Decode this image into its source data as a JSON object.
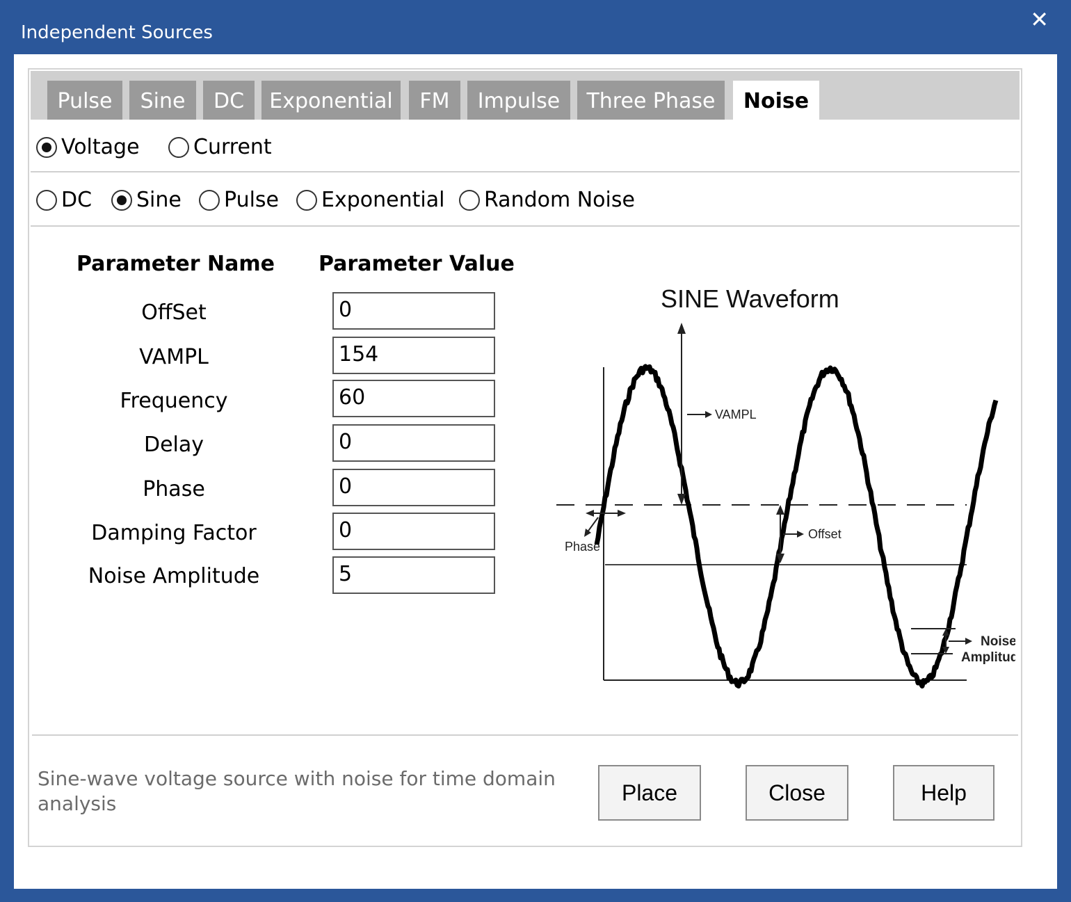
{
  "window": {
    "title": "Independent Sources",
    "close_glyph": "✕"
  },
  "tabs": [
    {
      "label": "Pulse"
    },
    {
      "label": "Sine"
    },
    {
      "label": "DC"
    },
    {
      "label": "Exponential"
    },
    {
      "label": "FM"
    },
    {
      "label": "Impulse"
    },
    {
      "label": "Three Phase"
    },
    {
      "label": "Noise",
      "active": true
    }
  ],
  "source_type": {
    "options": [
      {
        "label": "Voltage",
        "selected": true
      },
      {
        "label": "Current",
        "selected": false
      }
    ]
  },
  "waveform_type": {
    "options": [
      {
        "label": "DC",
        "selected": false
      },
      {
        "label": "Sine",
        "selected": true
      },
      {
        "label": "Pulse",
        "selected": false
      },
      {
        "label": "Exponential",
        "selected": false
      },
      {
        "label": "Random Noise",
        "selected": false
      }
    ]
  },
  "params": {
    "name_header": "Parameter Name",
    "value_header": "Parameter Value",
    "rows": [
      {
        "name": "OffSet",
        "value": "0"
      },
      {
        "name": "VAMPL",
        "value": "154"
      },
      {
        "name": "Frequency",
        "value": "60"
      },
      {
        "name": "Delay",
        "value": "0"
      },
      {
        "name": "Phase",
        "value": "0"
      },
      {
        "name": "Damping Factor",
        "value": "0"
      },
      {
        "name": "Noise Amplitude",
        "value": "5"
      }
    ]
  },
  "diagram": {
    "title": "SINE Waveform",
    "labels": {
      "vampl": "VAMPL",
      "offset": "Offset",
      "phase": "Phase",
      "noise_1": "Noise",
      "noise_2": "Amplitude"
    }
  },
  "footer": {
    "description": "Sine-wave voltage source with noise for time domain analysis",
    "place_label": "Place",
    "close_label": "Close",
    "help_label": "Help"
  },
  "colors": {
    "titlebar": "#2b579a",
    "tab_inactive": "#9a9a9a",
    "tabbar": "#cfcfcf"
  }
}
